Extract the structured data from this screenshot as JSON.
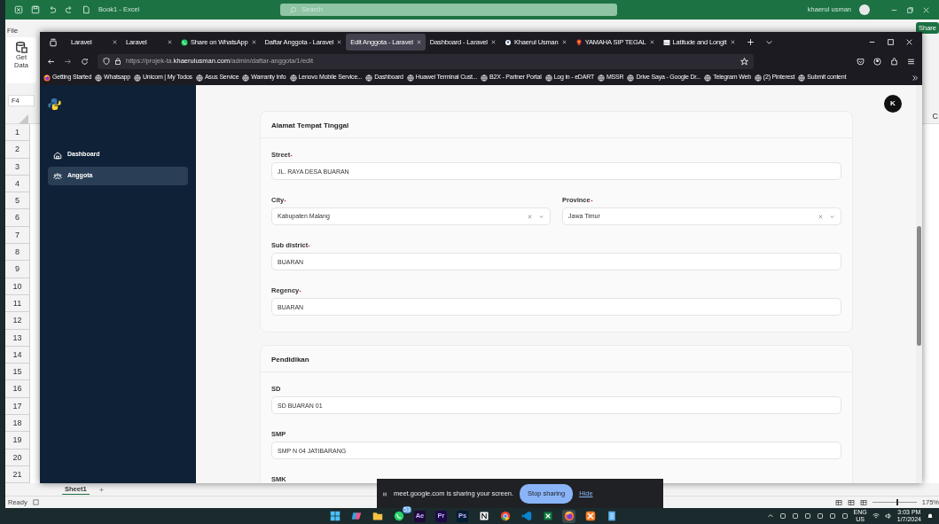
{
  "excel": {
    "title": "Book1 - Excel",
    "search_placeholder": "Search",
    "user": "khaerul usman",
    "ribbon_tab": "File",
    "get_data": "Get Data",
    "share": "Share",
    "name_box": "F4",
    "column_header": "C",
    "row_numbers": [
      "1",
      "2",
      "3",
      "4",
      "5",
      "6",
      "7",
      "8",
      "9",
      "10",
      "11",
      "12",
      "13",
      "14",
      "15",
      "16",
      "17",
      "18",
      "19",
      "20",
      "21"
    ],
    "sheets": [
      {
        "label": "Sheet1",
        "selected": true
      }
    ],
    "status": "Ready",
    "zoom": {
      "level": 0.55,
      "reading": "175%"
    }
  },
  "browser": {
    "tabs": [
      {
        "title": "Laravel",
        "kind": "plain",
        "selected": false
      },
      {
        "title": "Laravel",
        "kind": "plain",
        "selected": false
      },
      {
        "title": "Share on WhatsApp",
        "kind": "whatsapp",
        "selected": false
      },
      {
        "title": "Daftar Anggota - Laravel",
        "kind": "plain",
        "selected": false
      },
      {
        "title": "Edit Anggota - Laravel",
        "kind": "plain",
        "selected": true
      },
      {
        "title": "Dashboard - Laravel",
        "kind": "plain",
        "selected": false
      },
      {
        "title": "Khaerul Usman",
        "kind": "profile",
        "selected": false
      },
      {
        "title": "YAMAHA SIP TEGAL",
        "kind": "maps",
        "selected": false
      },
      {
        "title": "Latitude and Longit",
        "kind": "image",
        "selected": false
      }
    ],
    "url": "https://projek-ta.**khaerulusman.com**/admin/daftar-anggota/1/edit",
    "bookmarks": [
      {
        "label": "Getting Started",
        "kind": "firefox"
      },
      {
        "label": "Whatsapp",
        "kind": "globe"
      },
      {
        "label": "Unicom | My Todos",
        "kind": "globe"
      },
      {
        "label": "Asus Service",
        "kind": "globe"
      },
      {
        "label": "Warranty Info",
        "kind": "globe"
      },
      {
        "label": "Lenovo Mobile Service...",
        "kind": "globe"
      },
      {
        "label": "Dashboard",
        "kind": "globe"
      },
      {
        "label": "Huawei Terminal Cust...",
        "kind": "globe"
      },
      {
        "label": "B2X - Partner Portal",
        "kind": "globe"
      },
      {
        "label": "Log in - eDART",
        "kind": "globe"
      },
      {
        "label": "MSSR",
        "kind": "globe"
      },
      {
        "label": "Drive Saya - Google Dr...",
        "kind": "globe"
      },
      {
        "label": "Telegram Web",
        "kind": "globe"
      },
      {
        "label": "(2) Pinterest",
        "kind": "globe"
      },
      {
        "label": "Submit content",
        "kind": "globe"
      }
    ]
  },
  "app": {
    "nav": [
      {
        "label": "Dashboard",
        "kind": "home",
        "selected": false
      },
      {
        "label": "Anggota",
        "kind": "people",
        "selected": true
      }
    ],
    "avatar": "K",
    "cards": [
      {
        "title": "Alamat Tempat Tinggal",
        "rows": [
          {
            "fields": [
              {
                "label": "Street",
                "required": true,
                "kind": "text",
                "value": "JL. RAYA DESA BUARAN"
              }
            ]
          },
          {
            "fields": [
              {
                "label": "City",
                "required": true,
                "kind": "select",
                "value": "Kabupaten Malang"
              },
              {
                "label": "Province",
                "required": true,
                "kind": "select",
                "value": "Jawa Timur"
              }
            ]
          },
          {
            "fields": [
              {
                "label": "Sub district",
                "required": true,
                "kind": "text",
                "value": "BUARAN"
              }
            ]
          },
          {
            "fields": [
              {
                "label": "Regency",
                "required": true,
                "kind": "text",
                "value": "BUARAN"
              }
            ]
          }
        ]
      },
      {
        "title": "Pendidikan",
        "rows": [
          {
            "fields": [
              {
                "label": "SD",
                "required": false,
                "kind": "text",
                "value": "SD BUARAN 01"
              }
            ]
          },
          {
            "fields": [
              {
                "label": "SMP",
                "required": false,
                "kind": "text",
                "value": "SMP N 04 JATIBARANG"
              }
            ]
          },
          {
            "fields": [
              {
                "label": "SMK",
                "required": false
              }
            ]
          }
        ]
      }
    ]
  },
  "share_bar": {
    "message": "meet.google.com is sharing your screen.",
    "stop": "Stop sharing",
    "hide": "Hide"
  },
  "taskbar": {
    "apps": [
      {
        "kind": "start",
        "selected": false
      },
      {
        "kind": "copilot",
        "selected": false
      },
      {
        "kind": "folder",
        "selected": false
      },
      {
        "kind": "whatsapp",
        "badge": "53",
        "selected": false
      },
      {
        "kind": "adobe",
        "label": "Ae",
        "color": "#1f0a3d",
        "selected": false
      },
      {
        "kind": "adobe",
        "label": "Pr",
        "color": "#1e0a47",
        "selected": false
      },
      {
        "kind": "adobe",
        "label": "Ps",
        "color": "#001d34",
        "selected": false
      },
      {
        "kind": "notion",
        "selected": false
      },
      {
        "kind": "chrome",
        "selected": false
      },
      {
        "kind": "vscode",
        "selected": false
      },
      {
        "kind": "excel",
        "selected": false
      },
      {
        "kind": "firefox",
        "selected": true
      },
      {
        "kind": "xampp",
        "selected": false
      },
      {
        "kind": "notepad",
        "selected": false
      }
    ],
    "tray": {
      "language": "ENG",
      "region": "US",
      "time": "3:03 PM",
      "date": "1/7/2024"
    }
  }
}
